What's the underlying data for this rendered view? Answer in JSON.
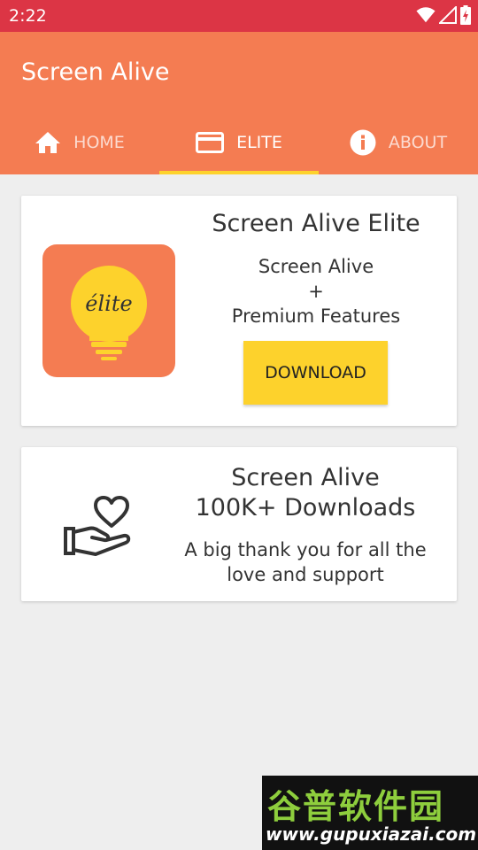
{
  "status_bar": {
    "time": "2:22",
    "icons": [
      "wifi-icon",
      "signal-icon",
      "battery-charging-icon"
    ]
  },
  "app_bar": {
    "title": "Screen Alive"
  },
  "tabs": [
    {
      "label": "HOME",
      "icon": "home-icon",
      "active": false
    },
    {
      "label": "ELITE",
      "icon": "credit-card-icon",
      "active": true
    },
    {
      "label": "ABOUT",
      "icon": "info-icon",
      "active": false
    }
  ],
  "elite_card": {
    "logo_text": "élite",
    "title": "Screen Alive Elite",
    "desc_line1": "Screen Alive",
    "desc_line2": "+",
    "desc_line3": "Premium Features",
    "download_label": "DOWNLOAD"
  },
  "thanks_card": {
    "icon": "heart-hand-icon",
    "title_line1": "Screen Alive",
    "title_line2": "100K+ Downloads",
    "desc_line1": "A big thank you for all the",
    "desc_line2": "love and support"
  },
  "watermark": {
    "top": "谷普软件园",
    "bottom": "www.gupuxiazai.com"
  },
  "colors": {
    "status": "#dc3545",
    "primary": "#f47c52",
    "accent": "#fdd22c",
    "background": "#eeeeee"
  }
}
